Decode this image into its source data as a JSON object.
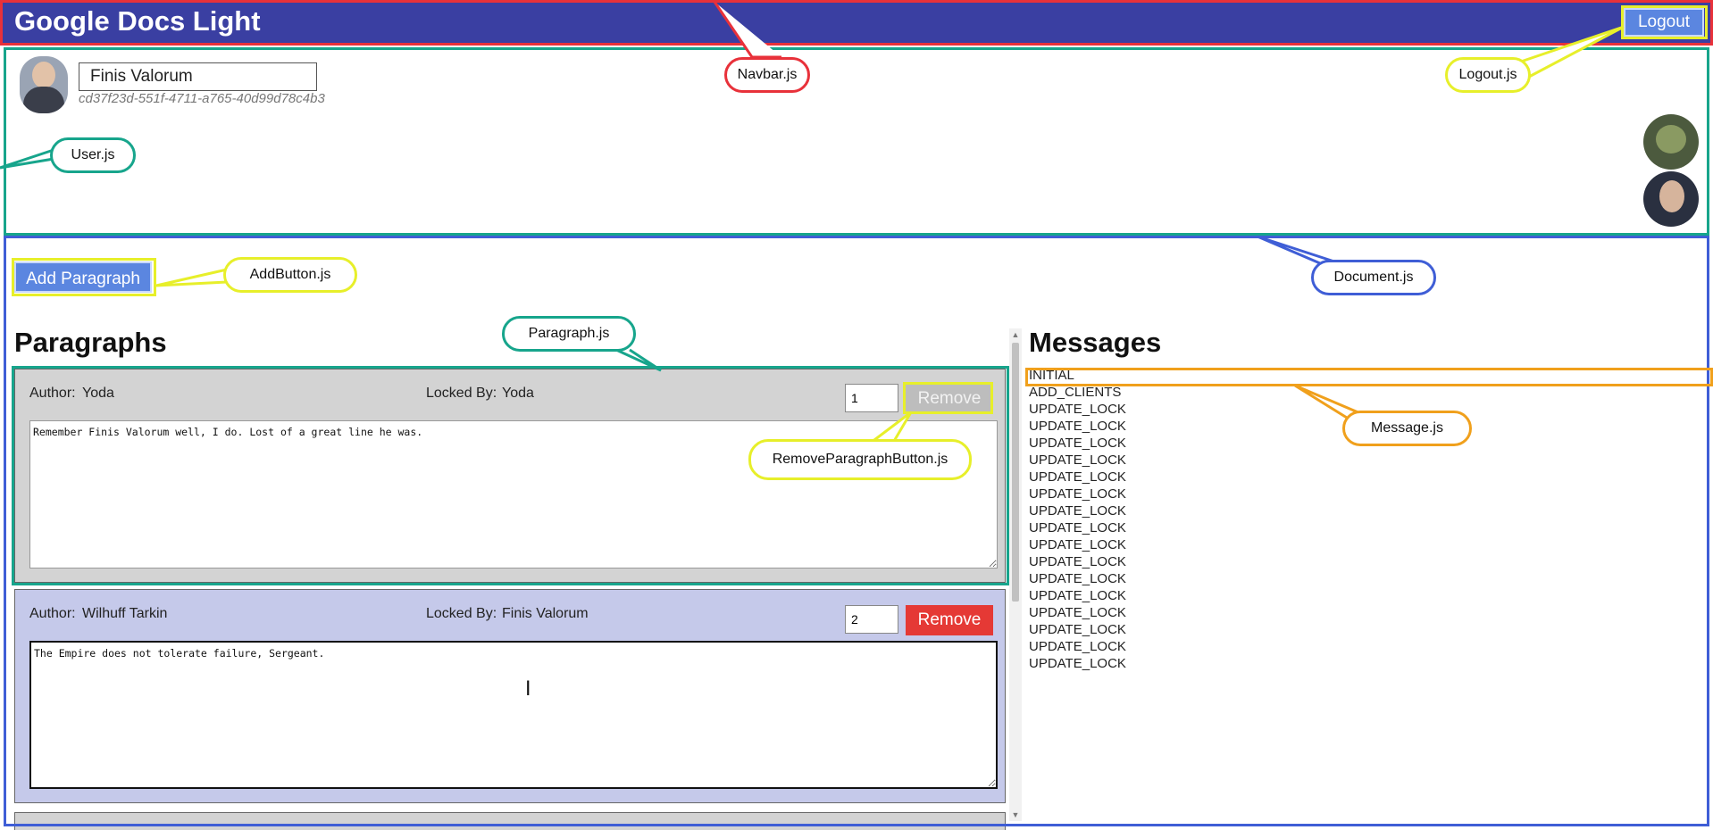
{
  "navbar": {
    "title": "Google Docs Light",
    "logout_label": "Logout"
  },
  "user": {
    "name": "Finis Valorum",
    "id": "cd37f23d-551f-4711-a765-40d99d78c4b3"
  },
  "connected_clients": [
    "Yoda",
    "Wilhuff Tarkin"
  ],
  "document": {
    "add_button_label": "Add Paragraph",
    "paragraphs_heading": "Paragraphs",
    "messages_heading": "Messages",
    "paragraphs": [
      {
        "author_label": "Author:",
        "author": "Yoda",
        "locked_label": "Locked By:",
        "locked_by": "Yoda",
        "order": "1",
        "remove_label": "Remove",
        "remove_enabled": false,
        "text": "Remember Finis Valorum well, I do. Lost of a great line he was."
      },
      {
        "author_label": "Author:",
        "author": "Wilhuff Tarkin",
        "locked_label": "Locked By:",
        "locked_by": "Finis Valorum",
        "order": "2",
        "remove_label": "Remove",
        "remove_enabled": true,
        "text": "The Empire does not tolerate failure, Sergeant."
      }
    ],
    "messages": [
      "INITIAL",
      "ADD_CLIENTS",
      "UPDATE_LOCK",
      "UPDATE_LOCK",
      "UPDATE_LOCK",
      "UPDATE_LOCK",
      "UPDATE_LOCK",
      "UPDATE_LOCK",
      "UPDATE_LOCK",
      "UPDATE_LOCK",
      "UPDATE_LOCK",
      "UPDATE_LOCK",
      "UPDATE_LOCK",
      "UPDATE_LOCK",
      "UPDATE_LOCK",
      "UPDATE_LOCK",
      "UPDATE_LOCK",
      "UPDATE_LOCK"
    ]
  },
  "annotations": {
    "navbar": "Navbar.js",
    "logout": "Logout.js",
    "user": "User.js",
    "add_button": "AddButton.js",
    "document": "Document.js",
    "paragraph": "Paragraph.js",
    "remove_button": "RemoveParagraphButton.js",
    "message": "Message.js"
  },
  "colors": {
    "navbar": "#3a3fa2",
    "primary_button": "#5b86e0",
    "remove_active": "#e53935",
    "remove_disabled": "#bdbdbd",
    "paragraph_unlocked": "#d3d3d3",
    "paragraph_own_lock": "#c5c9ea",
    "annotation_red": "#e8313a",
    "annotation_yellow": "#e7ef2a",
    "annotation_teal": "#17a58c",
    "annotation_blue": "#3f5ed6",
    "annotation_orange": "#f0a01c"
  }
}
